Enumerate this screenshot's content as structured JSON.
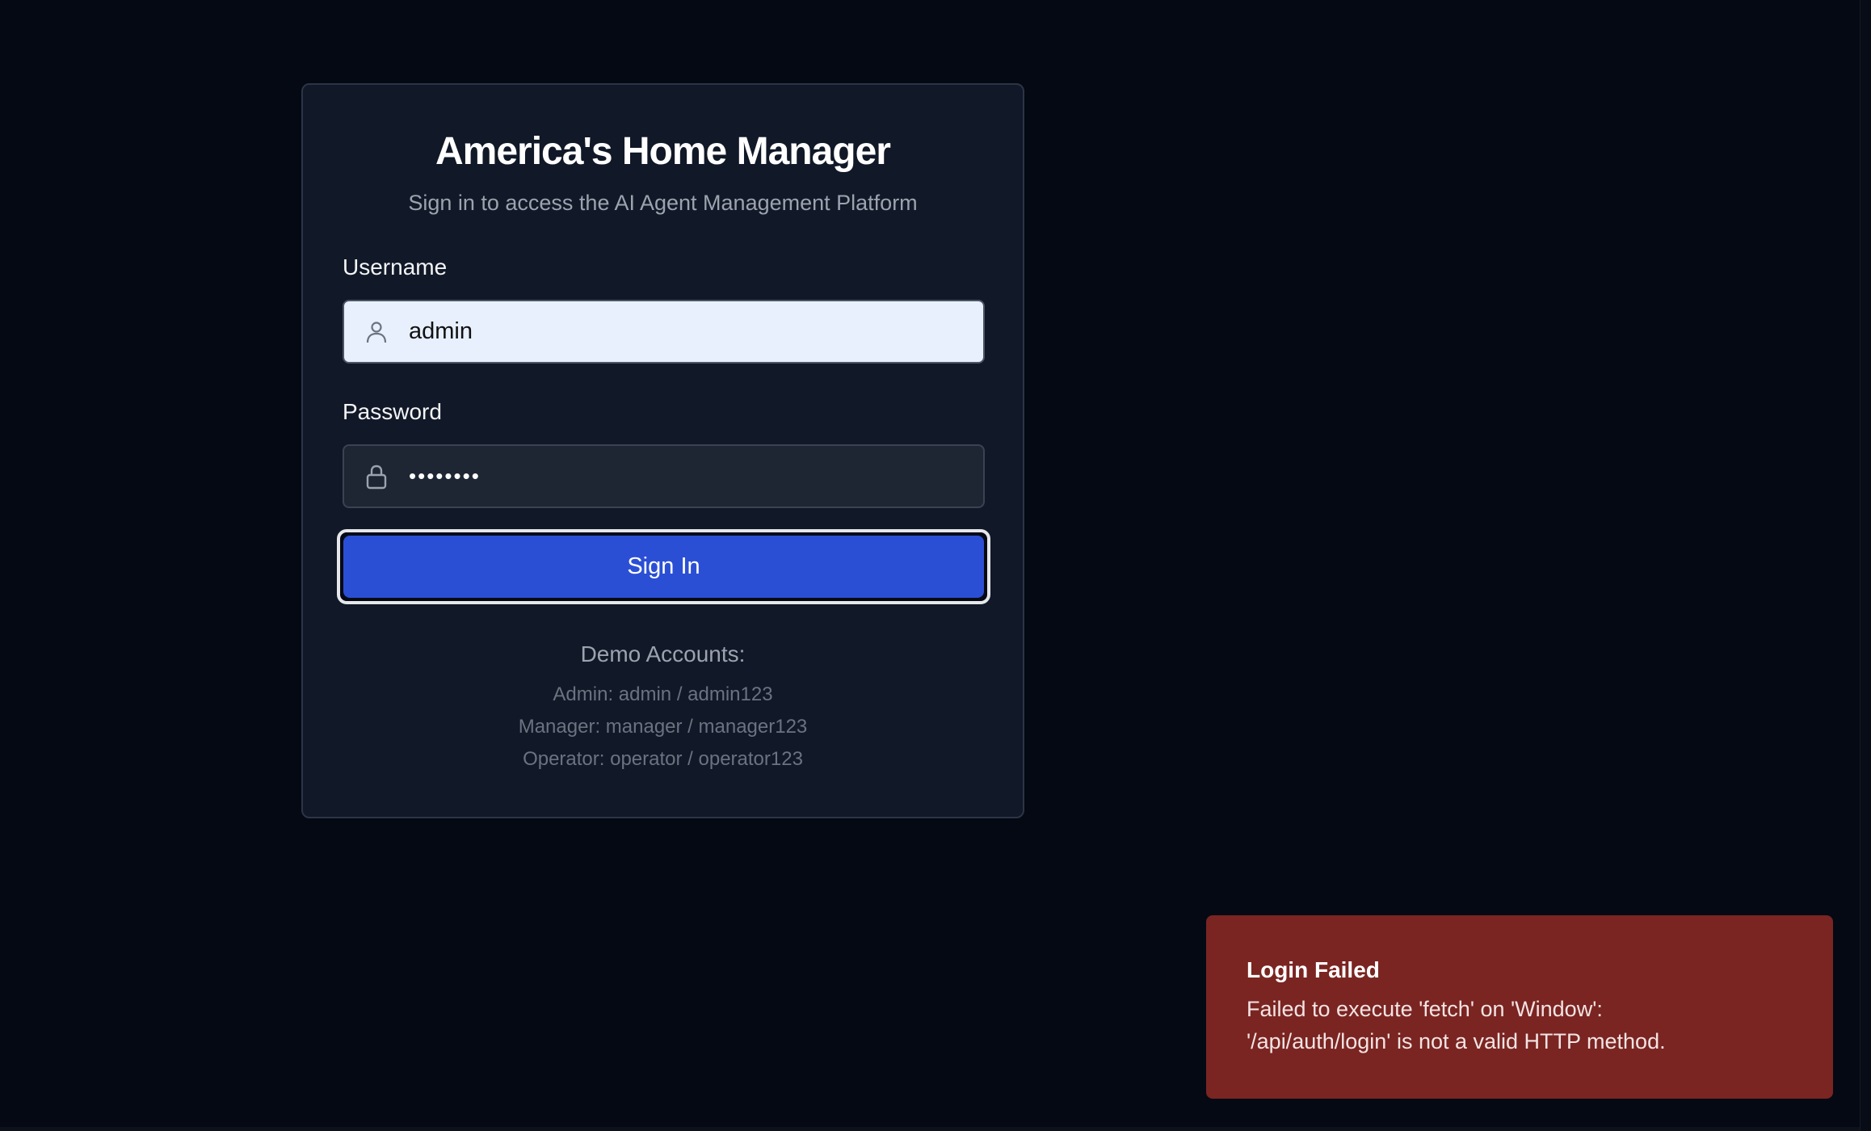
{
  "login": {
    "title": "America's Home Manager",
    "subtitle": "Sign in to access the AI Agent Management Platform",
    "username_label": "Username",
    "username_value": "admin",
    "password_label": "Password",
    "password_value": "••••••••",
    "signin_label": "Sign In"
  },
  "demo": {
    "title": "Demo Accounts:",
    "accounts": [
      "Admin: admin / admin123",
      "Manager: manager / manager123",
      "Operator: operator / operator123"
    ]
  },
  "toast": {
    "title": "Login Failed",
    "message": "Failed to execute 'fetch' on 'Window': '/api/auth/login' is not a valid HTTP method."
  },
  "icons": {
    "username": "user-icon",
    "password": "lock-icon"
  },
  "colors": {
    "background": "#050914",
    "card": "#111827",
    "primary_button": "#2b4fd4",
    "error_toast": "#7a2522"
  }
}
